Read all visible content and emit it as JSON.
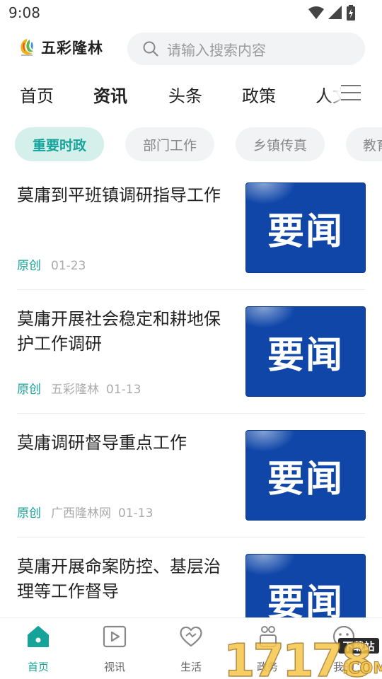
{
  "status_bar": {
    "time": "9:08"
  },
  "header": {
    "app_name": "五彩隆林",
    "search_placeholder": "请输入搜索内容"
  },
  "nav_tabs": [
    {
      "label": "首页",
      "active": false
    },
    {
      "label": "资讯",
      "active": true
    },
    {
      "label": "头条",
      "active": false
    },
    {
      "label": "政策",
      "active": false
    },
    {
      "label": "人文",
      "active": false
    }
  ],
  "chips": [
    {
      "label": "重要时政",
      "active": true
    },
    {
      "label": "部门工作",
      "active": false
    },
    {
      "label": "乡镇传真",
      "active": false
    },
    {
      "label": "教育",
      "active": false
    }
  ],
  "news": [
    {
      "title": "莫庸到平班镇调研指导工作",
      "tag": "原创",
      "source": "",
      "date": "01-23",
      "thumb_text": "要闻"
    },
    {
      "title": "莫庸开展社会稳定和耕地保护工作调研",
      "tag": "原创",
      "source": "五彩隆林",
      "date": "01-13",
      "thumb_text": "要闻"
    },
    {
      "title": "莫庸调研督导重点工作",
      "tag": "原创",
      "source": "广西隆林网",
      "date": "01-13",
      "thumb_text": "要闻"
    },
    {
      "title": "莫庸开展命案防控、基层治理等工作督导",
      "tag": "",
      "source": "",
      "date": "",
      "thumb_text": "要闻"
    }
  ],
  "bottom_nav": [
    {
      "label": "首页",
      "icon": "home-icon",
      "active": true
    },
    {
      "label": "视讯",
      "icon": "video-icon",
      "active": false
    },
    {
      "label": "生活",
      "icon": "heart-icon",
      "active": false
    },
    {
      "label": "政务",
      "icon": "government-icon",
      "active": false
    },
    {
      "label": "我的",
      "icon": "profile-icon",
      "active": false
    }
  ],
  "watermark": {
    "text": "17178",
    "suffix": ".COM",
    "badge": "下载站"
  },
  "colors": {
    "accent": "#15a39a",
    "thumb_blue": "#0f46a8",
    "chip_bg": "#f2f3f5"
  }
}
